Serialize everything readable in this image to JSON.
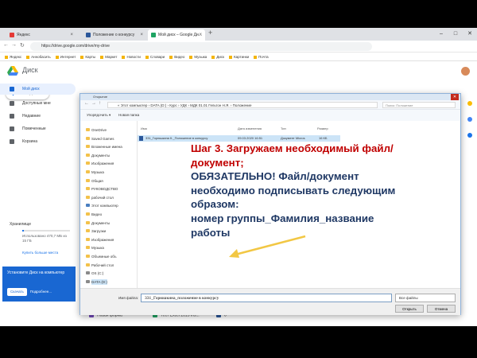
{
  "browser": {
    "tabs": [
      {
        "label": "Яндекс",
        "favicon_color": "#e53935"
      },
      {
        "label": "Положение о конкурсу",
        "favicon_color": "#2b579a"
      },
      {
        "label": "Мой диск – Google Ди...",
        "favicon_color": "#1fa463",
        "active": true
      }
    ],
    "new_tab": "+",
    "tab_close": "×",
    "url": "https://drive.google.com/drive/my-drive",
    "bookmarks": [
      "Яндекс",
      "Аннобасить",
      "Интернет",
      "Карты",
      "Маркет",
      "Новости",
      "Словари",
      "Видео",
      "Музыка",
      "Диск",
      "Картинки",
      "Почта"
    ]
  },
  "drive": {
    "title": "Диск",
    "create_label": "Создать",
    "sidebar": [
      {
        "label": "Мой диск",
        "active": true
      },
      {
        "label": "Доступные мне"
      },
      {
        "label": "Недавние"
      },
      {
        "label": "Помеченные"
      },
      {
        "label": "Корзина"
      }
    ],
    "storage_label": "Хранилище",
    "storage_used_fraction": 0.03,
    "storage_text": "Использовано 470,7 МБ из 15 ГБ",
    "buy_more": "Купить больше места",
    "install_text": "Установите Диск на компьютер",
    "install_download": "Скачать",
    "install_more": "Подробнее...",
    "files": [
      {
        "name": "Новая форма",
        "color": "#7248b9"
      },
      {
        "name": "Тест Excel 2015 Ins...",
        "color": "#1fa463"
      },
      {
        "name": "0",
        "color": "#2b579a"
      }
    ]
  },
  "dialog": {
    "title": "Открытие",
    "close": "✕",
    "breadcrumb": "« Этот компьютер › DATA (D:) › Курс › УДК › МДК 01.01 Гельтон Н.Я. › Положение",
    "search_placeholder": "Поиск: Положение",
    "toolbar_organize": "Упорядочить ▾",
    "toolbar_newfolder": "Новая папка",
    "nav": [
      {
        "label": "OneDrive",
        "kind": "folder"
      },
      {
        "label": "Saved Games",
        "kind": "folder"
      },
      {
        "label": "Вложенные имена",
        "kind": "folder"
      },
      {
        "label": "Документы",
        "kind": "folder"
      },
      {
        "label": "Изображения",
        "kind": "folder"
      },
      {
        "label": "Музыка",
        "kind": "folder"
      },
      {
        "label": "Общая",
        "kind": "folder"
      },
      {
        "label": "РУКОВОДСТВО",
        "kind": "folder"
      },
      {
        "label": "рабочий стол",
        "kind": "folder"
      },
      {
        "label": "Этот компьютер",
        "kind": "pc"
      },
      {
        "label": "Видео",
        "kind": "folder"
      },
      {
        "label": "Документы",
        "kind": "folder"
      },
      {
        "label": "Загрузки",
        "kind": "folder"
      },
      {
        "label": "Изображения",
        "kind": "folder"
      },
      {
        "label": "Музыка",
        "kind": "folder"
      },
      {
        "label": "Объемные объ",
        "kind": "folder"
      },
      {
        "label": "Рабочий стол",
        "kind": "folder"
      },
      {
        "label": "OS (C:)",
        "kind": "drive"
      },
      {
        "label": "DATA (D:)",
        "kind": "drive",
        "selected": true
      }
    ],
    "columns": [
      "Имя",
      "Дата изменения",
      "Тип",
      "Размер"
    ],
    "file": {
      "name": "331_Горюшкина К._Положение в конкурсу",
      "date": "09.03.2020 16:51",
      "type": "Документ Micros",
      "size": "16 КБ"
    },
    "filename_label": "Имя файла:",
    "filename_value": "331_Горюшкина_положение в конкурсу",
    "filter": "Все файлы",
    "open": "Открыть",
    "cancel": "Отмена"
  },
  "instruction": {
    "line1": "Шаг 3. Загружаем необходимый файл/документ;",
    "line2": "ОБЯЗАТЕЛЬНО! Файл/документ необходимо подписывать следующим образом:",
    "line3": "номер группы_Фамилия_название работы"
  },
  "colors": {
    "accent": "#1a73e8",
    "step_red": "#c00000",
    "step_blue": "#1f3864",
    "arrow": "#f2c744"
  }
}
